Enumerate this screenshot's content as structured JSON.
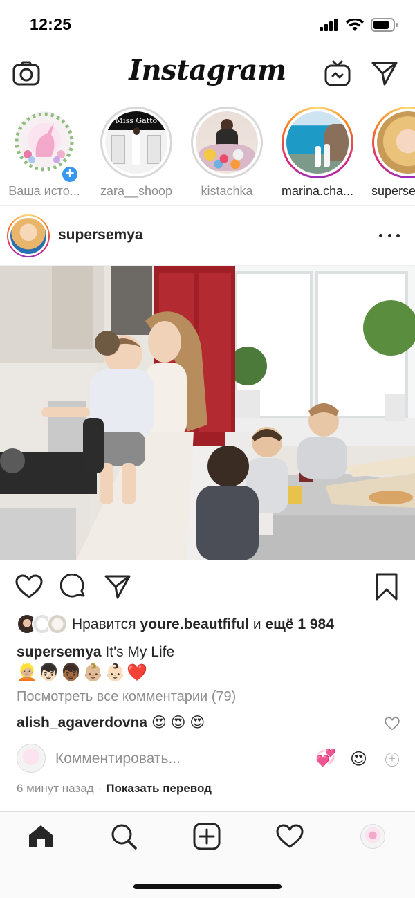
{
  "status_bar": {
    "time": "12:25"
  },
  "header": {
    "brand": "Instagram",
    "camera_icon": "camera-icon",
    "igtv_icon": "igtv-icon",
    "direct_icon": "paper-plane-icon"
  },
  "stories": [
    {
      "name": "Ваша исто...",
      "own": true,
      "ring": "seen"
    },
    {
      "name": "zara__shoop",
      "ring": "seen",
      "overlay_text": "Miss Gatto"
    },
    {
      "name": "kistachka",
      "ring": "seen"
    },
    {
      "name": "marina.cha...",
      "ring": "new"
    },
    {
      "name": "superse",
      "ring": "new"
    }
  ],
  "post": {
    "username": "supersemya",
    "more_icon": "ellipsis-icon",
    "likes": {
      "prefix": "Нравится",
      "user": "youre.beautfiful",
      "middle": "и",
      "count": "ещё 1 984"
    },
    "caption": {
      "user": "supersemya",
      "text": "It's My Life",
      "emoji": "👱🏼👦🏻👦🏾👶🏼👶🏻❤️"
    },
    "view_comments": "Посмотреть все комментарии (79)",
    "comment": {
      "user": "alish_agaverdovna",
      "text": "😍 😍 😍"
    },
    "add_comment": {
      "placeholder": "Комментировать...",
      "quick_1": "💞",
      "quick_2": "😍"
    },
    "time": "6 минут назад",
    "separator": "·",
    "translate": "Показать перевод"
  },
  "tab_bar": {
    "items": [
      "home-icon",
      "search-icon",
      "new-post-icon",
      "heart-icon",
      "profile-avatar"
    ]
  },
  "colors": {
    "accent_blue": "#3897f0",
    "text": "#262626",
    "muted": "#8e8e8e",
    "heart_red": "#ed4956"
  }
}
